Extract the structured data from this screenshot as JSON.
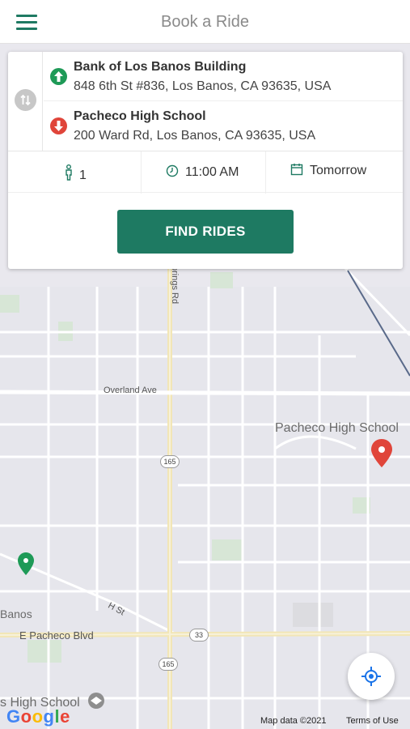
{
  "header": {
    "title": "Book a Ride"
  },
  "pickup": {
    "name": "Bank of Los Banos Building",
    "address": "848 6th St #836, Los Banos, CA 93635, USA"
  },
  "dropoff": {
    "name": "Pacheco High School",
    "address": "200 Ward Rd, Los Banos, CA 93635, USA"
  },
  "options": {
    "riders": "1",
    "time": "11:00 AM",
    "date": "Tomorrow"
  },
  "find_button": "FIND RIDES",
  "map": {
    "labels": {
      "overland": "Overland Ave",
      "springs": "prings Rd",
      "pacheco_hs": "Pacheco High School",
      "banos": "Banos",
      "h_st": "H St",
      "pacheco_blvd": "E Pacheco Blvd",
      "highschool_bottom": "s High School"
    },
    "shields": {
      "hw165_top": "165",
      "hw165_bottom": "165",
      "hw33": "33"
    },
    "attribution": "Map data ©2021",
    "terms": "Terms of Use",
    "logo": "Google"
  },
  "colors": {
    "brand": "#1e7a62",
    "pickup": "#1e9a57",
    "dropoff": "#e0453a"
  },
  "icons": [
    "menu-icon",
    "swap-icon",
    "pickup-arrow-icon",
    "dropoff-arrow-icon",
    "person-icon",
    "clock-icon",
    "calendar-icon",
    "locate-icon",
    "pin-icon"
  ]
}
